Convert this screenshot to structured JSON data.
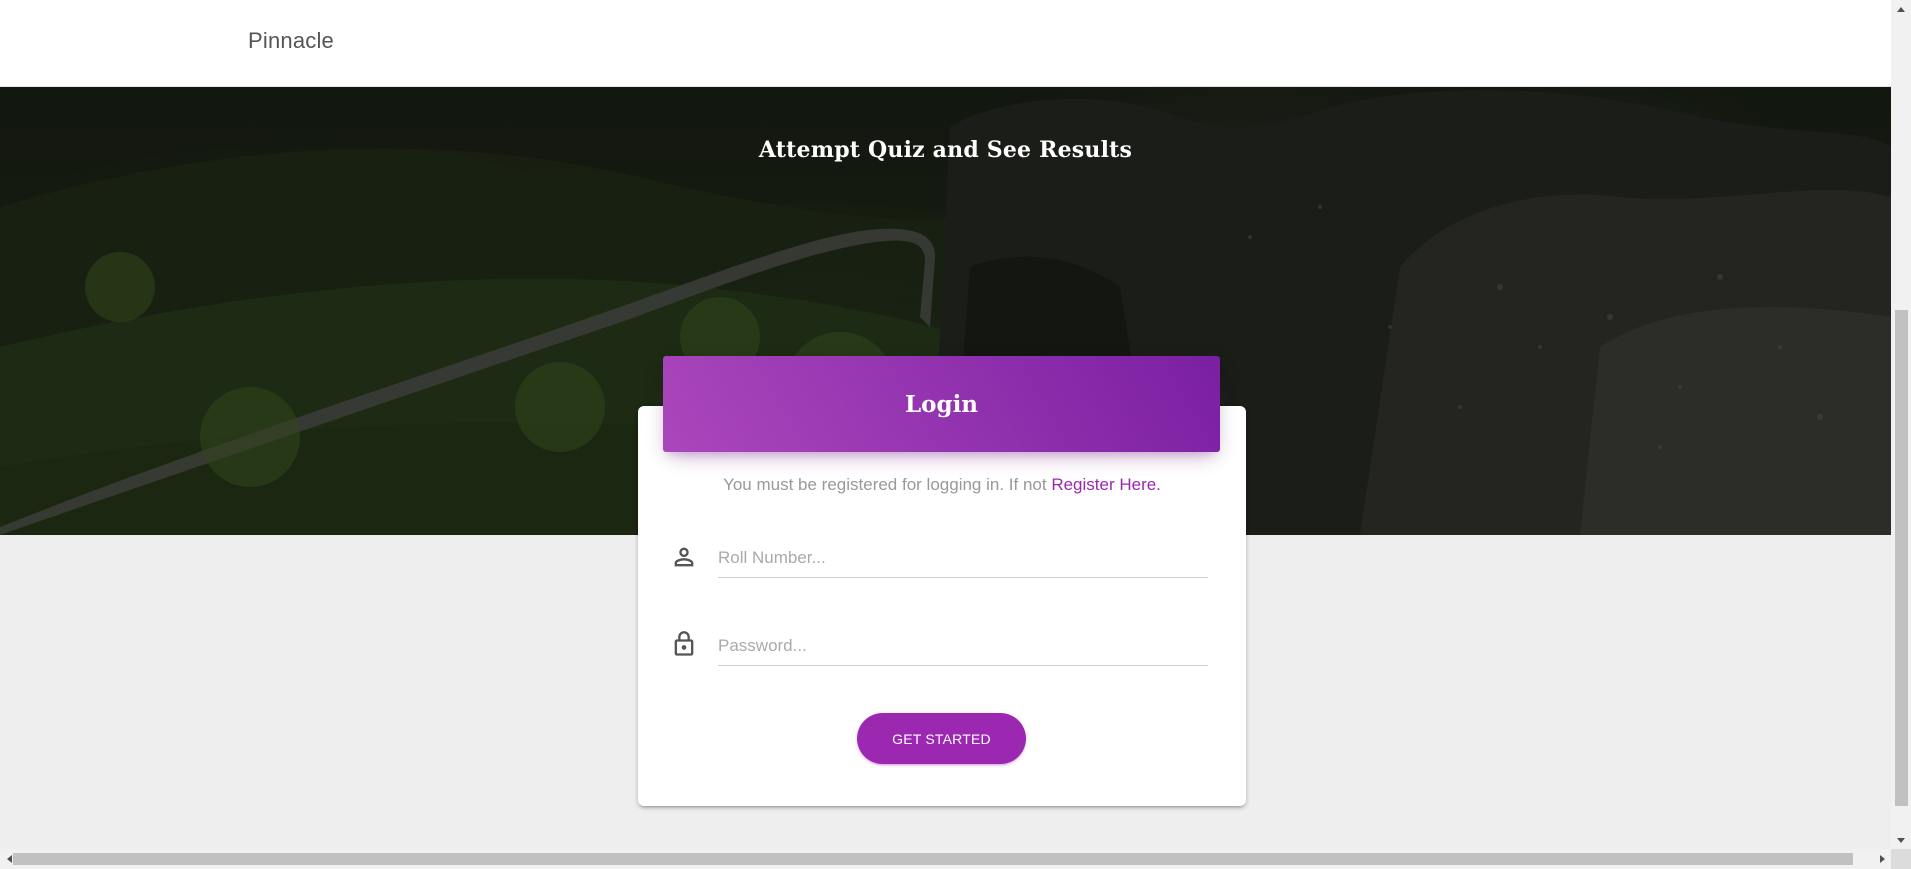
{
  "navbar": {
    "brand": "Pinnacle"
  },
  "hero": {
    "title": "Attempt Quiz and See Results"
  },
  "login_card": {
    "header": "Login",
    "description_prefix": "You must be registered for logging in. If not",
    "register_link": "Register Here.",
    "roll_number": {
      "placeholder": "Roll Number...",
      "value": "",
      "icon": "person-icon"
    },
    "password": {
      "placeholder": "Password...",
      "value": "",
      "icon": "lock-icon"
    },
    "submit_label": "GET STARTED"
  },
  "colors": {
    "primary": "#9c27b0",
    "header_gradient_start": "#ab47bc",
    "header_gradient_end": "#7b1fa2",
    "page_background": "#eeeeee",
    "muted_text": "#999999"
  }
}
